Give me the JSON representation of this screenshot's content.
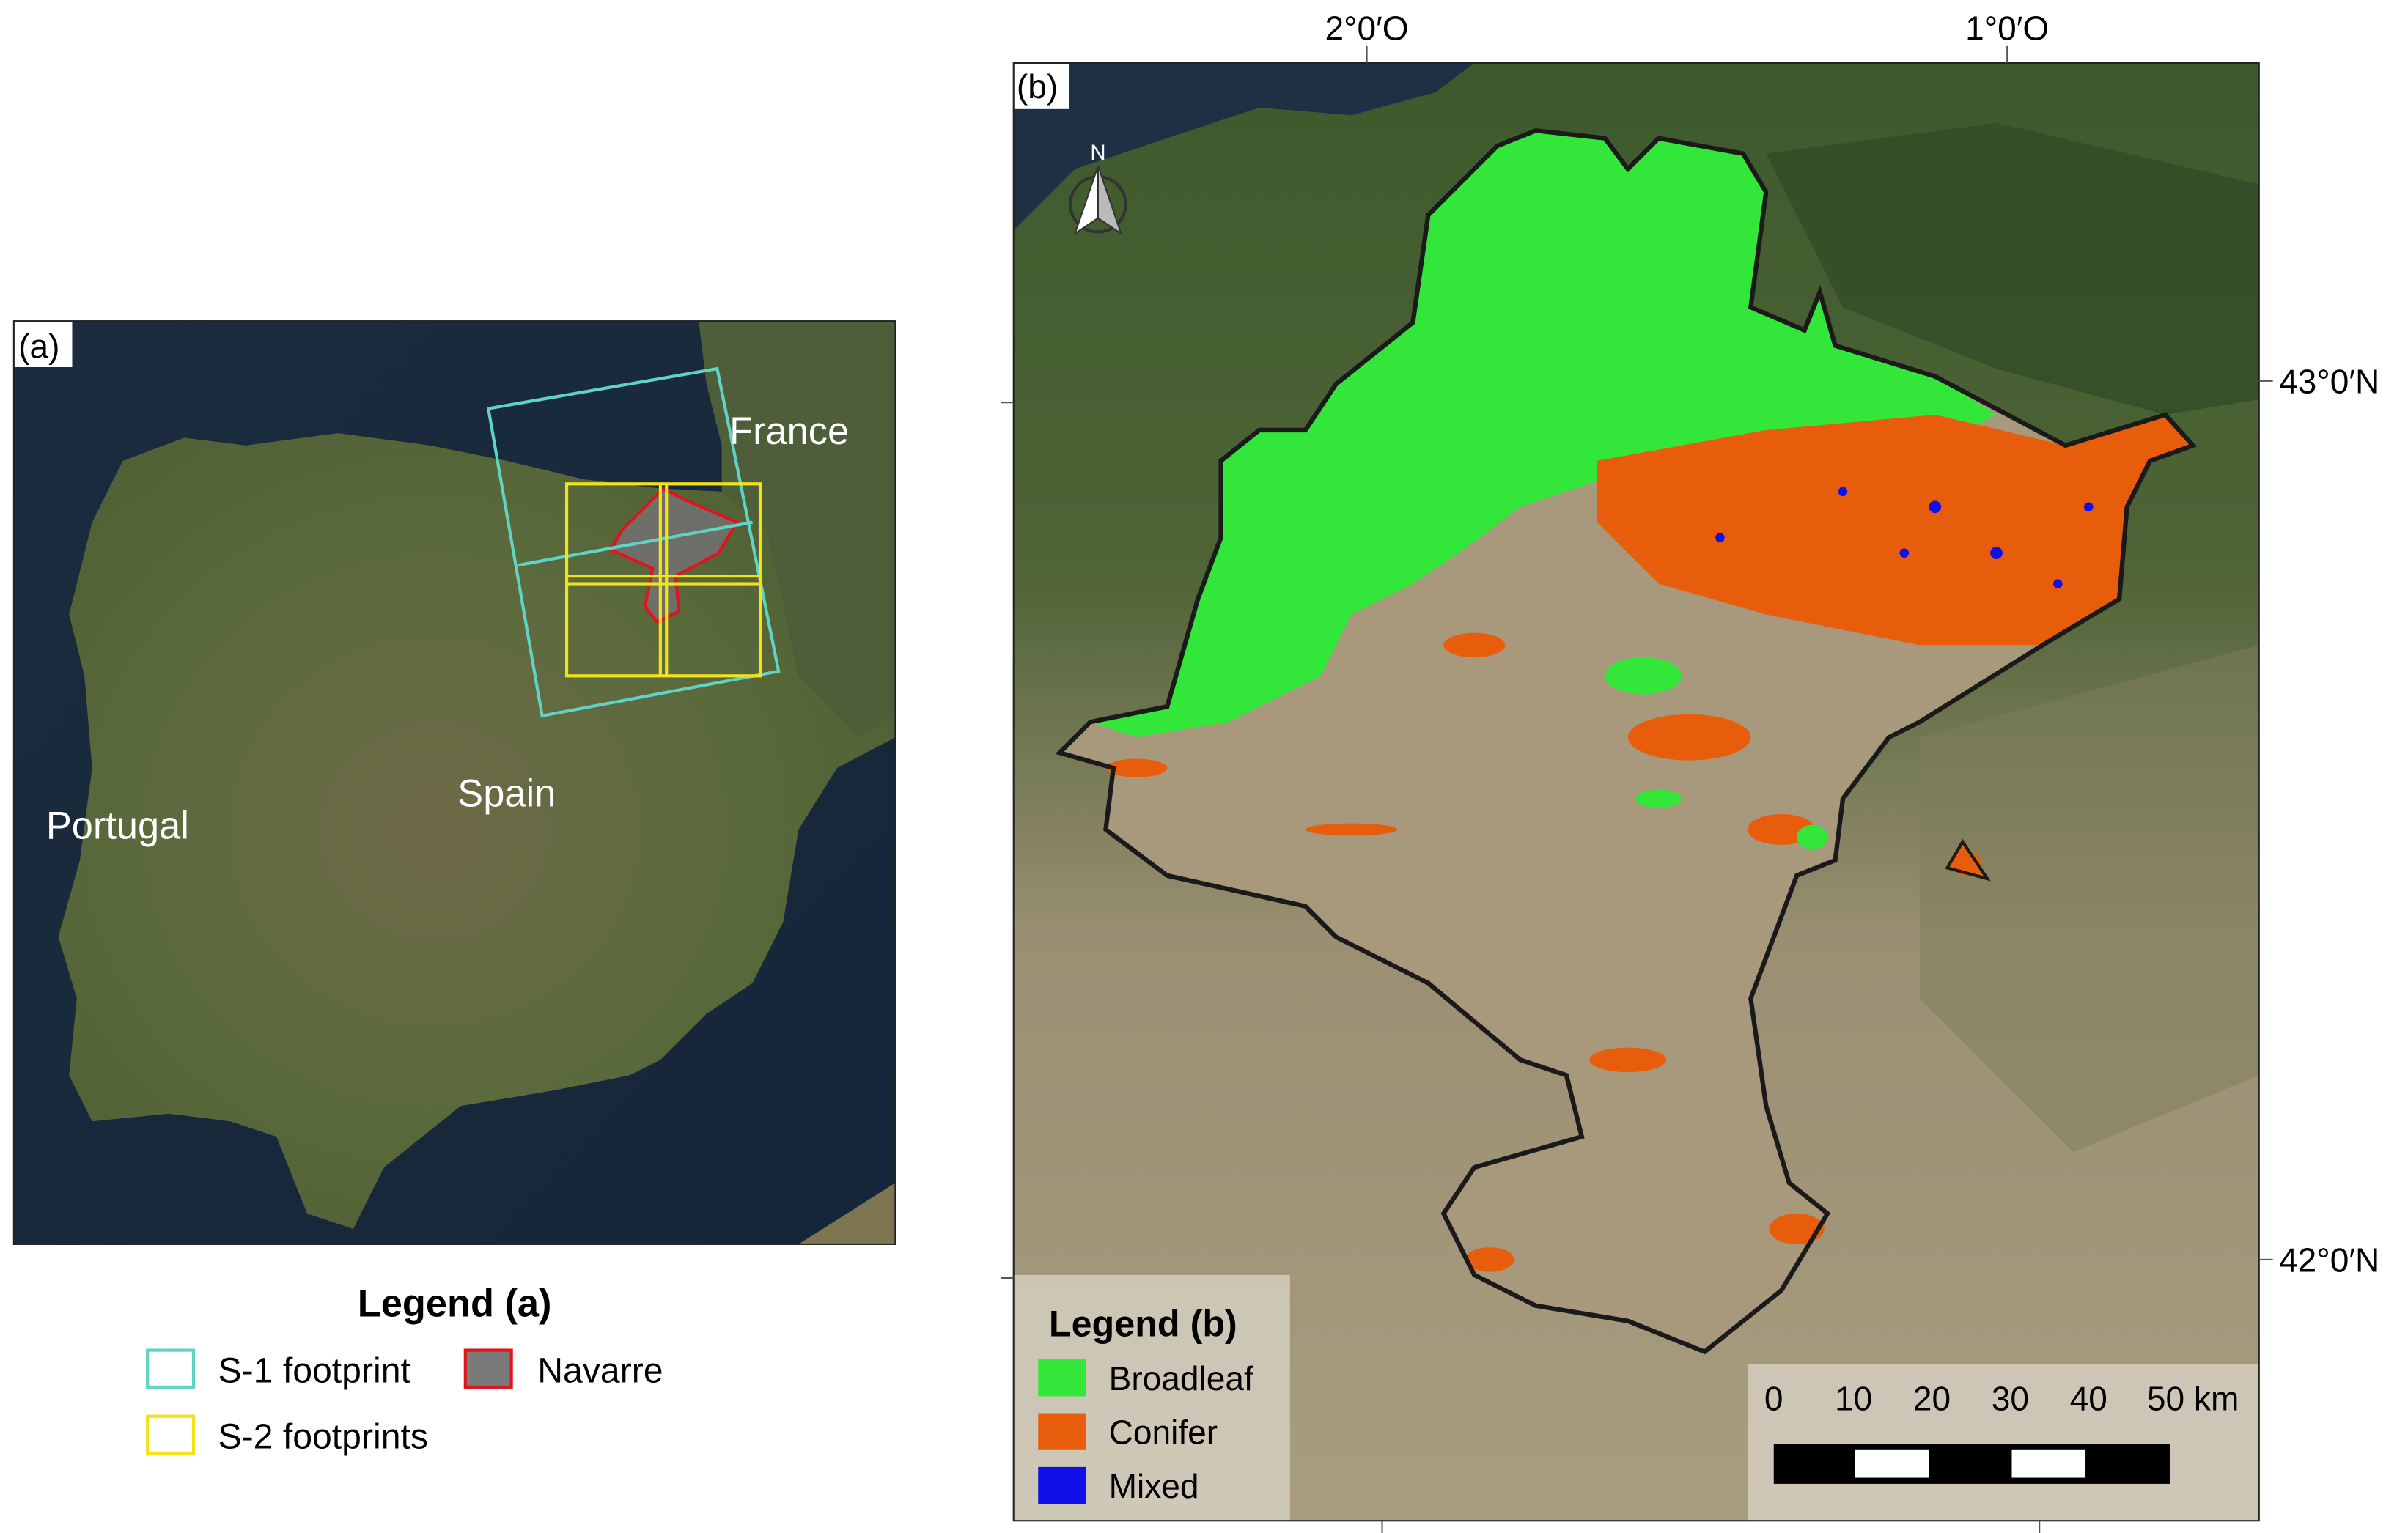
{
  "panel_a": {
    "label": "(a)",
    "countries": {
      "france": "France",
      "spain": "Spain",
      "portugal": "Portugal"
    },
    "legend": {
      "title": "Legend (a)",
      "items": [
        {
          "label": "S-1 footprint",
          "color": "#5fd3c4"
        },
        {
          "label": "Navarre",
          "color": "#7a7a7a",
          "border": "#e0141c"
        },
        {
          "label": "S-2 footprints",
          "color": "#f2e21a"
        }
      ]
    }
  },
  "panel_b": {
    "label": "(b)",
    "north_label": "N",
    "longitude_labels": [
      "2°0′O",
      "1°0′O"
    ],
    "latitude_labels": [
      "43°0′N",
      "42°0′N"
    ],
    "legend": {
      "title": "Legend (b)",
      "items": [
        {
          "label": "Broadleaf",
          "color": "#33e63a"
        },
        {
          "label": "Conifer",
          "color": "#e85d0c"
        },
        {
          "label": "Mixed",
          "color": "#1010e8"
        }
      ]
    },
    "scale_bar": {
      "ticks": [
        "0",
        "10",
        "20",
        "30",
        "40",
        "50 km"
      ]
    }
  }
}
